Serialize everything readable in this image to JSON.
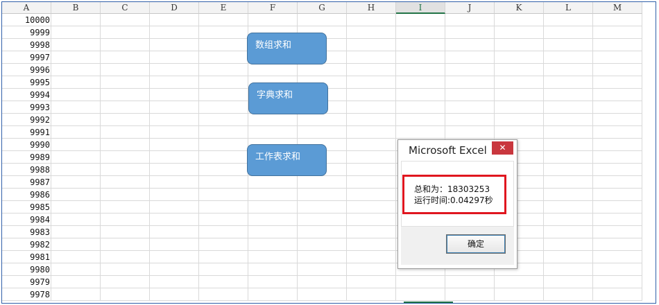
{
  "sheet": {
    "columns": [
      "A",
      "B",
      "C",
      "D",
      "E",
      "F",
      "G",
      "H",
      "I",
      "J",
      "K",
      "L",
      "M"
    ],
    "selected_column": "I",
    "col_a_values": [
      "10000",
      "9999",
      "9998",
      "9997",
      "9996",
      "9995",
      "9994",
      "9993",
      "9992",
      "9991",
      "9990",
      "9989",
      "9988",
      "9987",
      "9986",
      "9985",
      "9984",
      "9983",
      "9982",
      "9981",
      "9980",
      "9979",
      "9978"
    ]
  },
  "shapes": {
    "array_sum": "数组求和",
    "dict_sum": "字典求和",
    "sheet_sum": "工作表求和"
  },
  "dialog": {
    "title": "Microsoft Excel",
    "close_glyph": "✕",
    "line1": "总和为：18303253",
    "line2": "运行时间:0.04297秒",
    "ok_label": "确定"
  },
  "colors": {
    "shape_fill": "#5b9bd5",
    "highlight_border": "#e0161f",
    "close_button": "#c9373e",
    "selection": "#217346"
  }
}
